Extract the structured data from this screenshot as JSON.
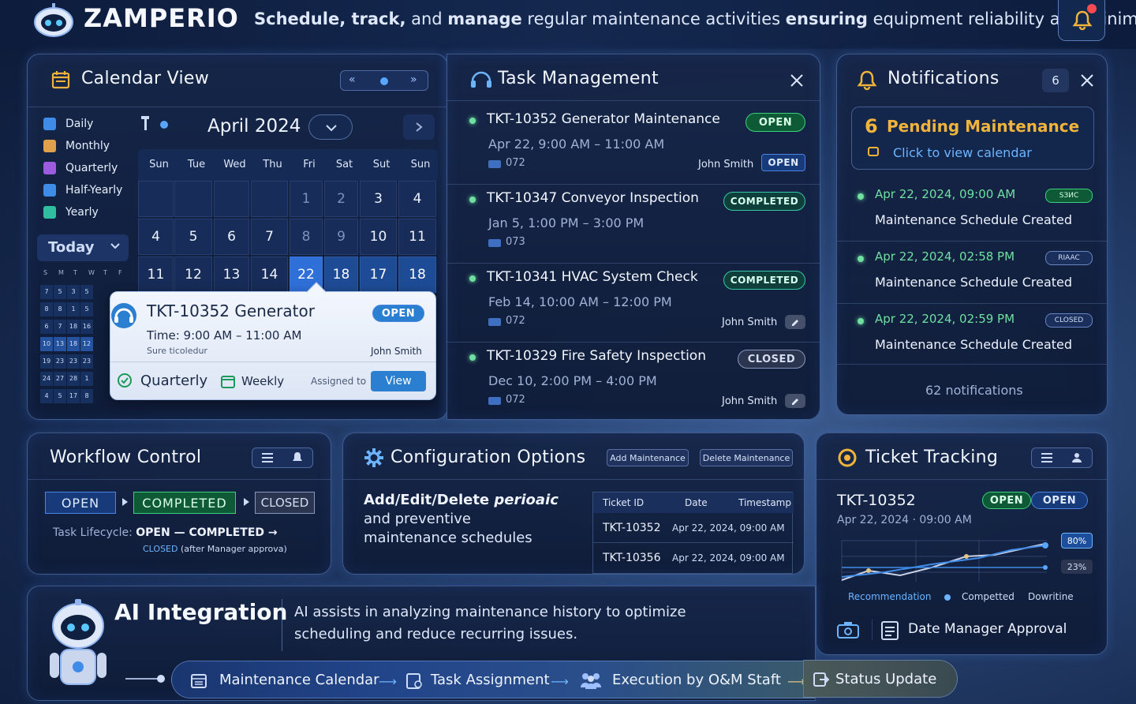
{
  "header": {
    "brand": "ZAMPERIO",
    "tagline_bold1": "Schedule, track,",
    "tagline_mid1": " and ",
    "tagline_bold2": "manage",
    "tagline_mid2": " regular maintenance activities ",
    "tagline_bold3": "ensuring",
    "tagline_end": " equipment reliability and minimal"
  },
  "calendar": {
    "title": "Calendar View",
    "month": "April 2024",
    "filters": [
      {
        "label": "Daily",
        "color": "#3f8be8"
      },
      {
        "label": "Monthly",
        "color": "#e0a14a"
      },
      {
        "label": "Quarterly",
        "color": "#9b5ce0"
      },
      {
        "label": "Half-Yearly",
        "color": "#3f8be8"
      },
      {
        "label": "Yearly",
        "color": "#2fbfa0"
      }
    ],
    "today_label": "Today",
    "weekdays": [
      "Sun",
      "Tue",
      "Wed",
      "Thu",
      "Fri",
      "Sat",
      "Sut",
      "Sun"
    ],
    "row1": [
      "",
      "",
      "",
      "",
      "1",
      "2",
      "3",
      "4"
    ],
    "row2": [
      "4",
      "5",
      "6",
      "7",
      "8",
      "9",
      "10",
      "11"
    ],
    "row3": [
      "11",
      "12",
      "13",
      "14",
      "22",
      "18",
      "17",
      "18"
    ],
    "mini_head": [
      "S",
      "M",
      "T",
      "W",
      "T",
      "F"
    ],
    "mini_rows": [
      [
        "7",
        "5",
        "3",
        "5",
        "",
        ""
      ],
      [
        "8",
        "8",
        "1",
        "5",
        "",
        ""
      ],
      [
        "6",
        "7",
        "18",
        "16",
        "",
        ""
      ],
      [
        "10",
        "13",
        "18",
        "12",
        "",
        ""
      ],
      [
        "19",
        "23",
        "23",
        "23",
        "",
        ""
      ],
      [
        "24",
        "27",
        "28",
        "1",
        "",
        ""
      ],
      [
        "4",
        "5",
        "17",
        "8",
        "",
        ""
      ]
    ],
    "popup": {
      "title": "TKT-10352 Generator",
      "status": "OPEN",
      "time": "Time: 9:00 AM – 11:00 AM",
      "note": "Sure ticoledur",
      "assignee": "John Smith",
      "freq1": "Quarterly",
      "freq2": "Weekly",
      "assigned_label": "Assigned to",
      "view_label": "View"
    }
  },
  "tasks": {
    "title": "Task Management",
    "items": [
      {
        "title": "TKT-10352 Generator Maintenance",
        "status": "OPEN",
        "time": "Apr 22, 9:00 AM – 11:00 AM",
        "code": "072",
        "assignee": "John Smith",
        "sub_status": "OPEN"
      },
      {
        "title": "TKT-10347 Conveyor Inspection",
        "status": "COMPLETED",
        "time": "Jan 5, 1:00 PM  – 3:00 PM",
        "code": "073",
        "assignee": "",
        "sub_status": ""
      },
      {
        "title": "TKT-10341 HVAC System Check",
        "status": "COMPLETED",
        "time": "Feb 14, 10:00 AM – 12:00 PM",
        "code": "072",
        "assignee": "John Smith",
        "sub_status": ""
      },
      {
        "title": "TKT-10329 Fire Safety Inspection",
        "status": "CLOSED",
        "time": "Dec 10, 2:00 PM  – 4:00 PM",
        "code": "072",
        "assignee": "John Smith",
        "sub_status": ""
      }
    ]
  },
  "notifications": {
    "title": "Notifications",
    "count": "6",
    "pending_num": "6",
    "pending_label": "Pending Maintenance",
    "pending_link": "Click to view calendar",
    "items": [
      {
        "time": "Apr 22, 2024, 09:00 AM",
        "tag": "SЗИС",
        "text": "Maintenance Schedule Created"
      },
      {
        "time": "Apr 22, 2024, 02:58 PM",
        "tag": "RIAAC",
        "text": "Maintenance Schedule Created"
      },
      {
        "time": "Apr 22, 2024, 02:59 PM",
        "tag": "CLOSED",
        "text": "Maintenance Schedule Created"
      }
    ],
    "footer": "62 notifications"
  },
  "workflow": {
    "title": "Workflow Control",
    "steps": [
      "OPEN",
      "COMPLETED",
      "CLOSED"
    ],
    "lifecycle_label": "Task Lifecycle:",
    "lifecycle_value": "OPEN — COMPLETED →",
    "closed_label": "CLOSED",
    "closed_note": "(after Manager approva)"
  },
  "config": {
    "title": "Configuration Options",
    "add_btn": "Add Maintenance",
    "delete_btn": "Delete Maintenance",
    "desc_bold": "Add/Edit/Delete ",
    "desc_italic": "perioaic",
    "desc_line2": "and preventive",
    "desc_line3": "maintenance schedules",
    "table_headers": [
      "Ticket ID",
      "Date",
      "Timestamp"
    ],
    "table_rows": [
      {
        "id": "TKT-10352",
        "date": "Apr 22,  2024,  09:00 AM"
      },
      {
        "id": "TKT-10356",
        "date": "Apr 22, 2024, 09:00 AM"
      }
    ]
  },
  "ticket": {
    "title": "Ticket Tracking",
    "id": "TKT-10352",
    "status1": "OPEN",
    "status2": "OPEN",
    "date": "Apr 22, 2024 · 09:00 AM",
    "pct_high": "80%",
    "pct_low": "23%",
    "legend": [
      "Recommendation",
      "Competted",
      "Dowritine"
    ],
    "approval": "Date Manager Approval"
  },
  "ai": {
    "title": "AI Integration",
    "desc_line1": "AI assists in analyzing maintenance history to optimize",
    "desc_line2": "scheduling and reduce recurring issues.",
    "flow": [
      "Maintenance Calendar",
      "Task Assignment",
      "Execution by O&M Staft",
      "Status Update"
    ]
  },
  "colors": {
    "accent": "#2f6fd8",
    "open": "#3ccf7c",
    "completed": "#38c7a8",
    "closed": "#8797bd",
    "gold": "#f0b43c"
  }
}
